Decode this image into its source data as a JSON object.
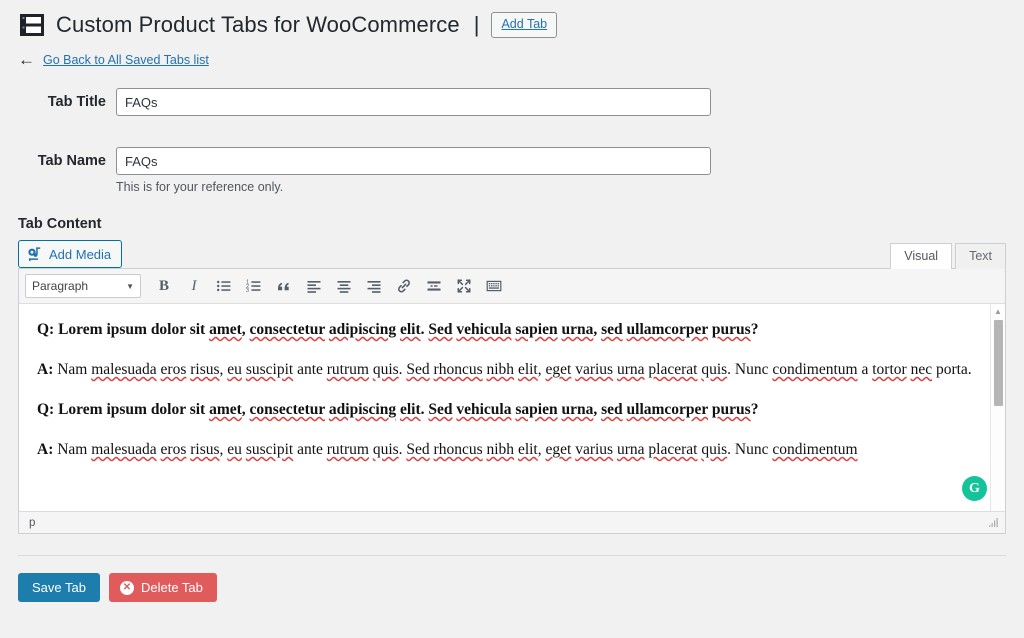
{
  "header": {
    "icon": "tabs-icon",
    "title": "Custom Product Tabs for WooCommerce",
    "separator": "|",
    "add_tab_label": "Add Tab",
    "back_arrow": "←",
    "back_link_label": "Go Back to All Saved Tabs list",
    "link_color": "#2271b1"
  },
  "form": {
    "tab_title": {
      "label": "Tab Title",
      "value": "FAQs",
      "placeholder": "Tab Title"
    },
    "tab_name": {
      "label": "Tab Name",
      "value": "FAQs",
      "placeholder": "Tab Name",
      "help": "This is for your reference only."
    }
  },
  "editor": {
    "section_label": "Tab Content",
    "add_media_label": "Add Media",
    "add_media_icon": "media-icon",
    "tabs": [
      {
        "label": "Visual",
        "active": true
      },
      {
        "label": "Text",
        "active": false
      }
    ],
    "toolbar": {
      "format_value": "Paragraph",
      "format_caret": "▼",
      "buttons": [
        {
          "name": "bold-icon",
          "glyph": "B"
        },
        {
          "name": "italic-icon",
          "glyph": "I"
        },
        {
          "name": "bulleted-list-icon",
          "glyph": ""
        },
        {
          "name": "numbered-list-icon",
          "glyph": ""
        },
        {
          "name": "blockquote-icon",
          "glyph": "❝"
        },
        {
          "name": "align-left-icon",
          "glyph": ""
        },
        {
          "name": "align-center-icon",
          "glyph": ""
        },
        {
          "name": "align-right-icon",
          "glyph": ""
        },
        {
          "name": "link-icon",
          "glyph": ""
        },
        {
          "name": "insert-read-more-icon",
          "glyph": ""
        },
        {
          "name": "fullscreen-icon",
          "glyph": ""
        },
        {
          "name": "toolbar-toggle-icon",
          "glyph": ""
        }
      ]
    },
    "content": {
      "paragraphs": [
        {
          "prefix": "Q:",
          "bold": true,
          "text": " Lorem ipsum dolor sit amet, consectetur adipiscing elit. Sed vehicula sapien urna, sed ullamcorper purus?"
        },
        {
          "prefix": "A:",
          "bold": false,
          "text": " Nam malesuada eros risus, eu suscipit ante rutrum quis. Sed rhoncus nibh elit, eget varius urna placerat quis. Nunc condimentum a tortor nec porta."
        },
        {
          "prefix": "Q:",
          "bold": true,
          "text": " Lorem ipsum dolor sit amet, consectetur adipiscing elit. Sed vehicula sapien urna, sed ullamcorper purus?"
        },
        {
          "prefix": "A:",
          "bold": false,
          "text": " Nam malesuada eros risus, eu suscipit ante rutrum quis. Sed rhoncus nibh elit, eget varius urna placerat quis. Nunc condimentum"
        }
      ]
    },
    "statusbar_path": "p",
    "grammarly_glyph": "G",
    "grammarly_color": "#15c39a"
  },
  "footer": {
    "save_label": "Save Tab",
    "save_color": "#1d7dad",
    "delete_label": "Delete Tab",
    "delete_color": "#e05c5c",
    "delete_icon_glyph": "✕"
  }
}
